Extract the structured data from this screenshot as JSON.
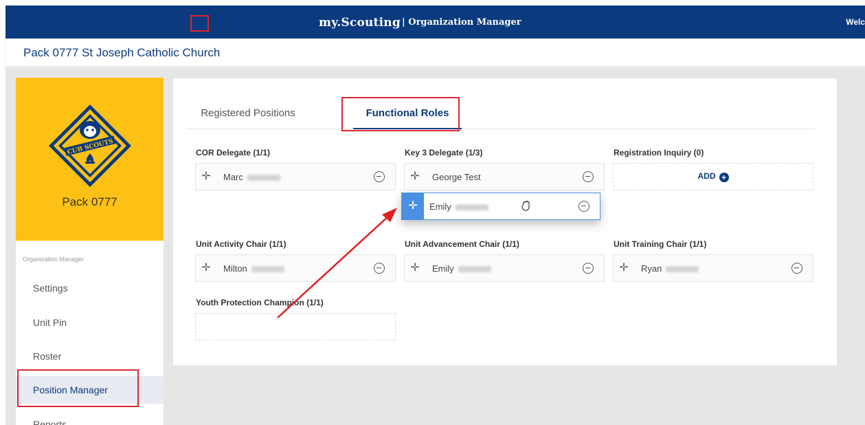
{
  "header": {
    "brand": "my.Scouting",
    "subtitle": "| Organization Manager",
    "welcome": "Welc"
  },
  "page": {
    "title": "Pack 0777 St Joseph Catholic Church"
  },
  "sidebar": {
    "unit_name": "Pack 0777",
    "logo_text": "CUB SCOUTS",
    "section_label": "Organization Manager",
    "items": [
      {
        "label": "Settings"
      },
      {
        "label": "Unit Pin"
      },
      {
        "label": "Roster"
      },
      {
        "label": "Position Manager",
        "active": true
      },
      {
        "label": "Reports"
      }
    ]
  },
  "tabs": [
    {
      "label": "Registered Positions",
      "selected": false
    },
    {
      "label": "Functional Roles",
      "selected": true
    }
  ],
  "roles": {
    "cor_delegate": {
      "label": "COR Delegate (1/1)",
      "members": [
        "Marc"
      ]
    },
    "key3_delegate": {
      "label": "Key 3 Delegate (1/3)",
      "members": [
        "George Test"
      ],
      "dragging": "Emily"
    },
    "registration_inquiry": {
      "label": "Registration Inquiry (0)",
      "add_label": "ADD"
    },
    "unit_activity_chair": {
      "label": "Unit Activity Chair (1/1)",
      "members": [
        "Milton"
      ]
    },
    "unit_advancement_chair": {
      "label": "Unit Advancement Chair (1/1)",
      "members": [
        "Emily"
      ]
    },
    "unit_training_chair": {
      "label": "Unit Training Chair (1/1)",
      "members": [
        "Ryan"
      ]
    },
    "youth_protection_champion": {
      "label": "Youth Protection Champion (1/1)",
      "members": []
    }
  },
  "icons": {
    "drag": "drag-handle-icon",
    "remove": "remove-circle-icon",
    "add": "add-circle-icon",
    "cursor": "grab-hand-icon"
  },
  "colors": {
    "header_blue": "#0b3a7e",
    "unit_yellow": "#fdc116",
    "highlight_red": "#d9272e",
    "drag_blue": "#4a90e2"
  }
}
